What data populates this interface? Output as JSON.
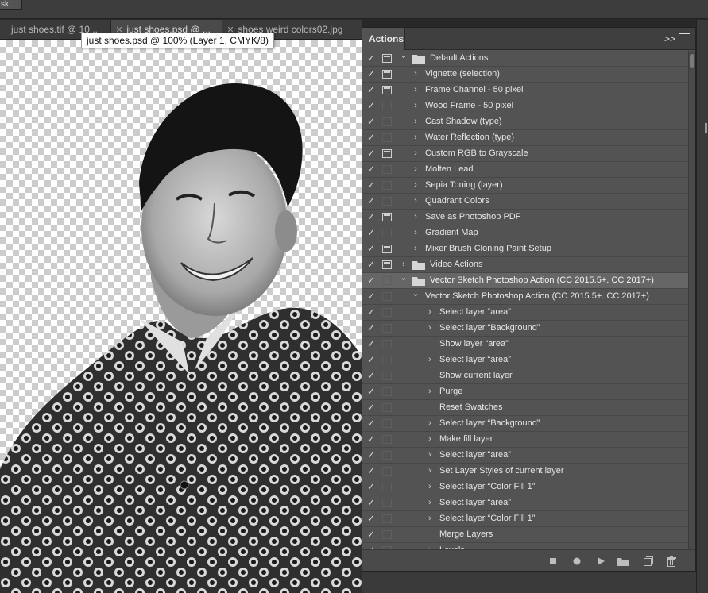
{
  "app_tab": {
    "label": "sk..."
  },
  "tabs": [
    {
      "label": "just shoes.tif @ 10..."
    },
    {
      "label": "just shoes.psd @ ..."
    },
    {
      "label": "shoes weird colors02.jpg"
    }
  ],
  "tooltip": "just shoes.psd @ 100% (Layer 1, CMYK/8)",
  "panel": {
    "title": "Actions",
    "collapse_glyph": ">>",
    "rows": [
      {
        "label": "Default Actions",
        "level": 0,
        "expanded": true,
        "folder": true,
        "dialog": true
      },
      {
        "label": "Vignette (selection)",
        "level": 1,
        "expanded": false,
        "dialog": true
      },
      {
        "label": "Frame Channel - 50 pixel",
        "level": 1,
        "expanded": false,
        "dialog": true
      },
      {
        "label": "Wood Frame - 50 pixel",
        "level": 1,
        "expanded": false,
        "dialog": false
      },
      {
        "label": "Cast Shadow (type)",
        "level": 1,
        "expanded": false,
        "dialog": false
      },
      {
        "label": "Water Reflection (type)",
        "level": 1,
        "expanded": false,
        "dialog": false
      },
      {
        "label": "Custom RGB to Grayscale",
        "level": 1,
        "expanded": false,
        "dialog": true
      },
      {
        "label": "Molten Lead",
        "level": 1,
        "expanded": false,
        "dialog": false
      },
      {
        "label": "Sepia Toning (layer)",
        "level": 1,
        "expanded": false,
        "dialog": false
      },
      {
        "label": "Quadrant Colors",
        "level": 1,
        "expanded": false,
        "dialog": false
      },
      {
        "label": "Save as Photoshop PDF",
        "level": 1,
        "expanded": false,
        "dialog": true
      },
      {
        "label": "Gradient Map",
        "level": 1,
        "expanded": false,
        "dialog": false
      },
      {
        "label": "Mixer Brush Cloning Paint Setup",
        "level": 1,
        "expanded": false,
        "dialog": true
      },
      {
        "label": "Video Actions",
        "level": 0,
        "expanded": false,
        "folder": true,
        "dialog": true
      },
      {
        "label": "Vector Sketch Photoshop Action (CC 2015.5+. CC 2017+)",
        "level": 0,
        "expanded": true,
        "folder": true,
        "dialog": false,
        "selected": true
      },
      {
        "label": "Vector Sketch Photoshop Action (CC 2015.5+. CC 2017+)",
        "level": 1,
        "expanded": true,
        "dialog": false
      },
      {
        "label": "Select layer “area”",
        "level": 2,
        "expanded": false,
        "dialog": false
      },
      {
        "label": "Select layer “Background”",
        "level": 2,
        "expanded": false,
        "dialog": false
      },
      {
        "label": "Show layer “area”",
        "level": 2,
        "expanded": null,
        "dialog": false
      },
      {
        "label": "Select layer “area”",
        "level": 2,
        "expanded": false,
        "dialog": false
      },
      {
        "label": "Show current layer",
        "level": 2,
        "expanded": null,
        "dialog": false
      },
      {
        "label": "Purge",
        "level": 2,
        "expanded": false,
        "dialog": false
      },
      {
        "label": "Reset Swatches",
        "level": 2,
        "expanded": null,
        "dialog": false
      },
      {
        "label": "Select layer “Background”",
        "level": 2,
        "expanded": false,
        "dialog": false
      },
      {
        "label": "Make fill layer",
        "level": 2,
        "expanded": false,
        "dialog": false
      },
      {
        "label": "Select layer “area”",
        "level": 2,
        "expanded": false,
        "dialog": false
      },
      {
        "label": "Set Layer Styles of current layer",
        "level": 2,
        "expanded": false,
        "dialog": false
      },
      {
        "label": "Select layer “Color Fill 1”",
        "level": 2,
        "expanded": false,
        "dialog": false
      },
      {
        "label": "Select layer “area”",
        "level": 2,
        "expanded": false,
        "dialog": false
      },
      {
        "label": "Select layer “Color Fill 1”",
        "level": 2,
        "expanded": false,
        "dialog": false
      },
      {
        "label": "Merge Layers",
        "level": 2,
        "expanded": null,
        "dialog": false
      },
      {
        "label": "Levels",
        "level": 2,
        "expanded": false,
        "dialog": false
      }
    ],
    "footer_icons": [
      "stop-icon",
      "record-icon",
      "play-icon",
      "new-set-icon",
      "new-action-icon",
      "trash-icon"
    ]
  },
  "colors": {
    "panel_bg": "#535353",
    "selected_row": "#666666",
    "text": "#e6e6e6"
  }
}
